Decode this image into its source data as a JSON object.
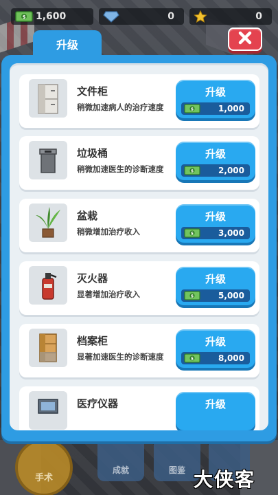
{
  "top_bar": {
    "cash": "1,600",
    "gems": "0",
    "stars": "0"
  },
  "tab": {
    "label": "升级"
  },
  "close": {
    "icon": "close-icon"
  },
  "upgrades": [
    {
      "name": "文件柜",
      "desc": "稍微加速病人的治疗速度",
      "button": "升级",
      "cost": "1,000",
      "icon": "file-cabinet-icon"
    },
    {
      "name": "垃圾桶",
      "desc": "稍微加速医生的诊断速度",
      "button": "升级",
      "cost": "2,000",
      "icon": "trash-bin-icon"
    },
    {
      "name": "盆栽",
      "desc": "稍微增加治疗收入",
      "button": "升级",
      "cost": "3,000",
      "icon": "potted-plant-icon"
    },
    {
      "name": "灭火器",
      "desc": "显著增加治疗收入",
      "button": "升级",
      "cost": "5,000",
      "icon": "fire-extinguisher-icon"
    },
    {
      "name": "档案柜",
      "desc": "显著加速医生的诊断速度",
      "button": "升级",
      "cost": "8,000",
      "icon": "archive-cabinet-icon"
    },
    {
      "name": "医疗仪器",
      "desc": "",
      "button": "升级",
      "cost": "",
      "icon": "medical-device-icon"
    }
  ],
  "bottom_nav": {
    "surgery": "手术",
    "achievements": "成就",
    "catalog": "图鉴"
  },
  "watermark": "大侠客",
  "colors": {
    "panel_blue": "#2e9ce3",
    "button_blue": "#29a9f0",
    "cost_bar": "#1a5c9c",
    "close_red": "#e4434f"
  }
}
